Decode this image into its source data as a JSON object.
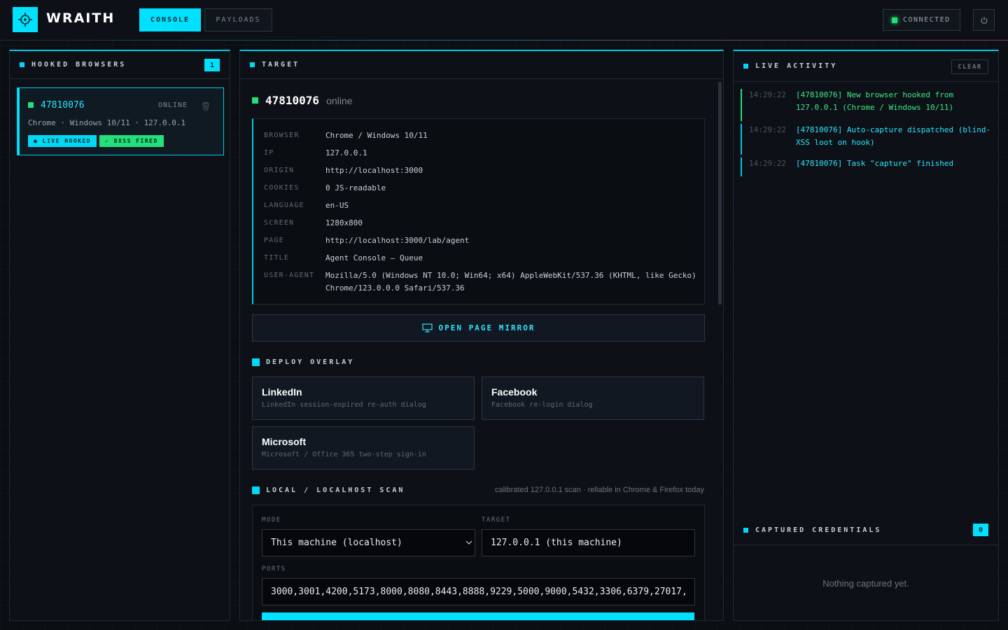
{
  "app": {
    "name": "WRAITH"
  },
  "nav": {
    "console": "CONSOLE",
    "payloads": "PAYLOADS"
  },
  "status": {
    "connection": "CONNECTED"
  },
  "hooked": {
    "title": "HOOKED BROWSERS",
    "count": "1",
    "browser": {
      "id": "47810076",
      "status": "ONLINE",
      "meta": "Chrome · Windows 10/11 · 127.0.0.1",
      "tag_live": "● LIVE HOOKED",
      "tag_bxss": "✓ BXSS FIRED"
    }
  },
  "target": {
    "title": "TARGET",
    "id": "47810076",
    "state": "online",
    "fields": [
      {
        "k": "BROWSER",
        "v": "Chrome / Windows 10/11"
      },
      {
        "k": "IP",
        "v": "127.0.0.1"
      },
      {
        "k": "ORIGIN",
        "v": "http://localhost:3000"
      },
      {
        "k": "COOKIES",
        "v": "0 JS-readable"
      },
      {
        "k": "LANGUAGE",
        "v": "en-US"
      },
      {
        "k": "SCREEN",
        "v": "1280x800"
      },
      {
        "k": "PAGE",
        "v": "http://localhost:3000/lab/agent"
      },
      {
        "k": "TITLE",
        "v": "Agent Console — Queue"
      },
      {
        "k": "USER-AGENT",
        "v": "Mozilla/5.0 (Windows NT 10.0; Win64; x64) AppleWebKit/537.36 (KHTML, like Gecko) Chrome/123.0.0.0 Safari/537.36"
      }
    ],
    "mirror_button": "OPEN PAGE MIRROR"
  },
  "overlay": {
    "title": "DEPLOY OVERLAY",
    "cards": [
      {
        "title": "LinkedIn",
        "desc": "LinkedIn session-expired re-auth dialog"
      },
      {
        "title": "Facebook",
        "desc": "Facebook re-login dialog"
      },
      {
        "title": "Microsoft",
        "desc": "Microsoft / Office 365 two-step sign-in"
      }
    ]
  },
  "scan": {
    "title": "LOCAL / LOCALHOST SCAN",
    "note": "calibrated 127.0.0.1 scan · reliable in Chrome & Firefox today",
    "mode_label": "MODE",
    "mode_value": "This machine (localhost)",
    "target_label": "TARGET",
    "target_value": "127.0.0.1 (this machine)",
    "ports_label": "PORTS",
    "ports_value": "3000,3001,4200,5173,8000,8080,8443,8888,9229,5000,9000,5432,3306,6379,27017,"
  },
  "activity": {
    "title": "LIVE ACTIVITY",
    "clear": "CLEAR",
    "entries": [
      {
        "ts": "14:29:22",
        "msg": "[47810076] New browser hooked from 127.0.0.1 (Chrome / Windows 10/11)"
      },
      {
        "ts": "14:29:22",
        "msg": "[47810076] Auto-capture dispatched (blind-XSS loot on hook)"
      },
      {
        "ts": "14:29:22",
        "msg": "[47810076] Task \"capture\" finished"
      }
    ]
  },
  "credentials": {
    "title": "CAPTURED CREDENTIALS",
    "count": "0",
    "empty": "Nothing captured yet."
  },
  "colors": {
    "accent": "#00e1ff",
    "success": "#22e07a",
    "background": "#0b0e13"
  }
}
